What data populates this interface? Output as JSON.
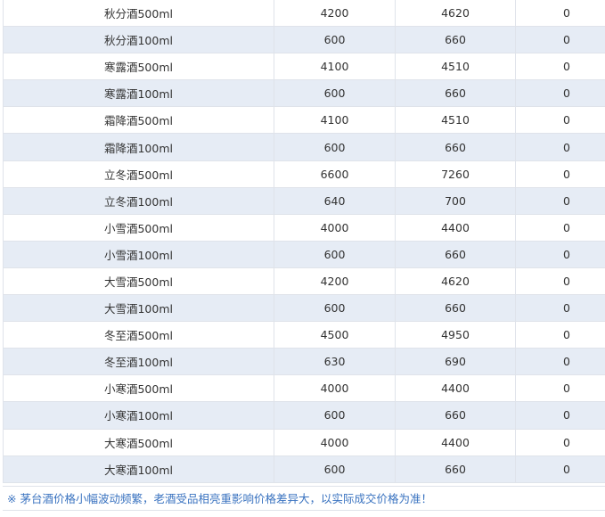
{
  "table": {
    "rows": [
      {
        "name": "秋分酒500ml",
        "v1": "4200",
        "v2": "4620",
        "v3": "0"
      },
      {
        "name": "秋分酒100ml",
        "v1": "600",
        "v2": "660",
        "v3": "0"
      },
      {
        "name": "寒露酒500ml",
        "v1": "4100",
        "v2": "4510",
        "v3": "0"
      },
      {
        "name": "寒露酒100ml",
        "v1": "600",
        "v2": "660",
        "v3": "0"
      },
      {
        "name": "霜降酒500ml",
        "v1": "4100",
        "v2": "4510",
        "v3": "0"
      },
      {
        "name": "霜降酒100ml",
        "v1": "600",
        "v2": "660",
        "v3": "0"
      },
      {
        "name": "立冬酒500ml",
        "v1": "6600",
        "v2": "7260",
        "v3": "0"
      },
      {
        "name": "立冬酒100ml",
        "v1": "640",
        "v2": "700",
        "v3": "0"
      },
      {
        "name": "小雪酒500ml",
        "v1": "4000",
        "v2": "4400",
        "v3": "0"
      },
      {
        "name": "小雪酒100ml",
        "v1": "600",
        "v2": "660",
        "v3": "0"
      },
      {
        "name": "大雪酒500ml",
        "v1": "4200",
        "v2": "4620",
        "v3": "0"
      },
      {
        "name": "大雪酒100ml",
        "v1": "600",
        "v2": "660",
        "v3": "0"
      },
      {
        "name": "冬至酒500ml",
        "v1": "4500",
        "v2": "4950",
        "v3": "0"
      },
      {
        "name": "冬至酒100ml",
        "v1": "630",
        "v2": "690",
        "v3": "0"
      },
      {
        "name": "小寒酒500ml",
        "v1": "4000",
        "v2": "4400",
        "v3": "0"
      },
      {
        "name": "小寒酒100ml",
        "v1": "600",
        "v2": "660",
        "v3": "0"
      },
      {
        "name": "大寒酒500ml",
        "v1": "4000",
        "v2": "4400",
        "v3": "0"
      },
      {
        "name": "大寒酒100ml",
        "v1": "600",
        "v2": "660",
        "v3": "0"
      }
    ]
  },
  "note": "※ 茅台酒价格小幅波动频繁，老酒受品相亮重影响价格差异大，以实际成交价格为准！",
  "colors": {
    "stripe": "#e6ecf5",
    "border": "#dfe3ea",
    "note_text": "#3a73c0"
  }
}
